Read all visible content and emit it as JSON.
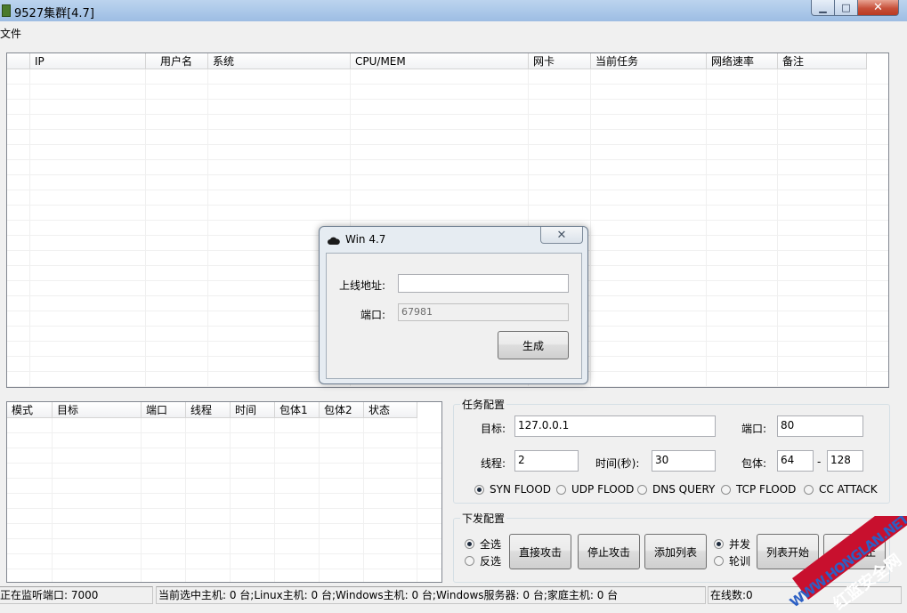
{
  "window": {
    "title": "9527集群[4.7]",
    "minimize_glyph": "▁",
    "maximize_glyph": "□",
    "close_glyph": "✕"
  },
  "menu": {
    "file": "文件"
  },
  "hosts": {
    "columns": [
      "",
      "IP",
      "用户名",
      "系统",
      "CPU/MEM",
      "网卡",
      "当前任务",
      "网络速率",
      "备注"
    ]
  },
  "tasks": {
    "columns": [
      "模式",
      "目标",
      "端口",
      "线程",
      "时间",
      "包体1",
      "包体2",
      "状态"
    ]
  },
  "task_config": {
    "title": "任务配置",
    "target_label": "目标:",
    "target_value": "127.0.0.1",
    "port_label": "端口:",
    "port_value": "80",
    "threads_label": "线程:",
    "threads_value": "2",
    "time_label": "时间(秒):",
    "time_value": "30",
    "packet_label": "包体:",
    "packet_min": "64",
    "packet_sep": "-",
    "packet_max": "128",
    "attack_modes": [
      {
        "label": "SYN FLOOD",
        "selected": true
      },
      {
        "label": "UDP FLOOD",
        "selected": false
      },
      {
        "label": "DNS QUERY",
        "selected": false
      },
      {
        "label": "TCP FLOOD",
        "selected": false
      },
      {
        "label": "CC ATTACK",
        "selected": false
      }
    ]
  },
  "dispatch": {
    "title": "下发配置",
    "select_all": "全选",
    "invert": "反选",
    "direct_attack": "直接攻击",
    "stop_attack": "停止攻击",
    "add_list": "添加列表",
    "concurrent": "并发",
    "round_robin": "轮训",
    "list_start": "列表开始",
    "list_stop": "列表停止"
  },
  "status": {
    "listen": "正在监听端口: 7000",
    "selected": "当前选中主机: 0 台;Linux主机: 0 台;Windows主机: 0 台;Windows服务器: 0 台;家庭主机: 0 台",
    "online": "在线数:0"
  },
  "dialog": {
    "title": "Win 4.7",
    "close_glyph": "✕",
    "addr_label": "上线地址:",
    "addr_value": "",
    "port_label": "端口:",
    "port_value": "67981",
    "generate": "生成"
  },
  "watermark": {
    "line1": "WWW.HONGLAN.NET",
    "line2": "红蓝安全网"
  },
  "colors": {
    "titlebar": "#a9c6e8",
    "close": "#c7503a",
    "watermark_red": "#c8102e",
    "watermark_blue": "#2c5fc4"
  }
}
